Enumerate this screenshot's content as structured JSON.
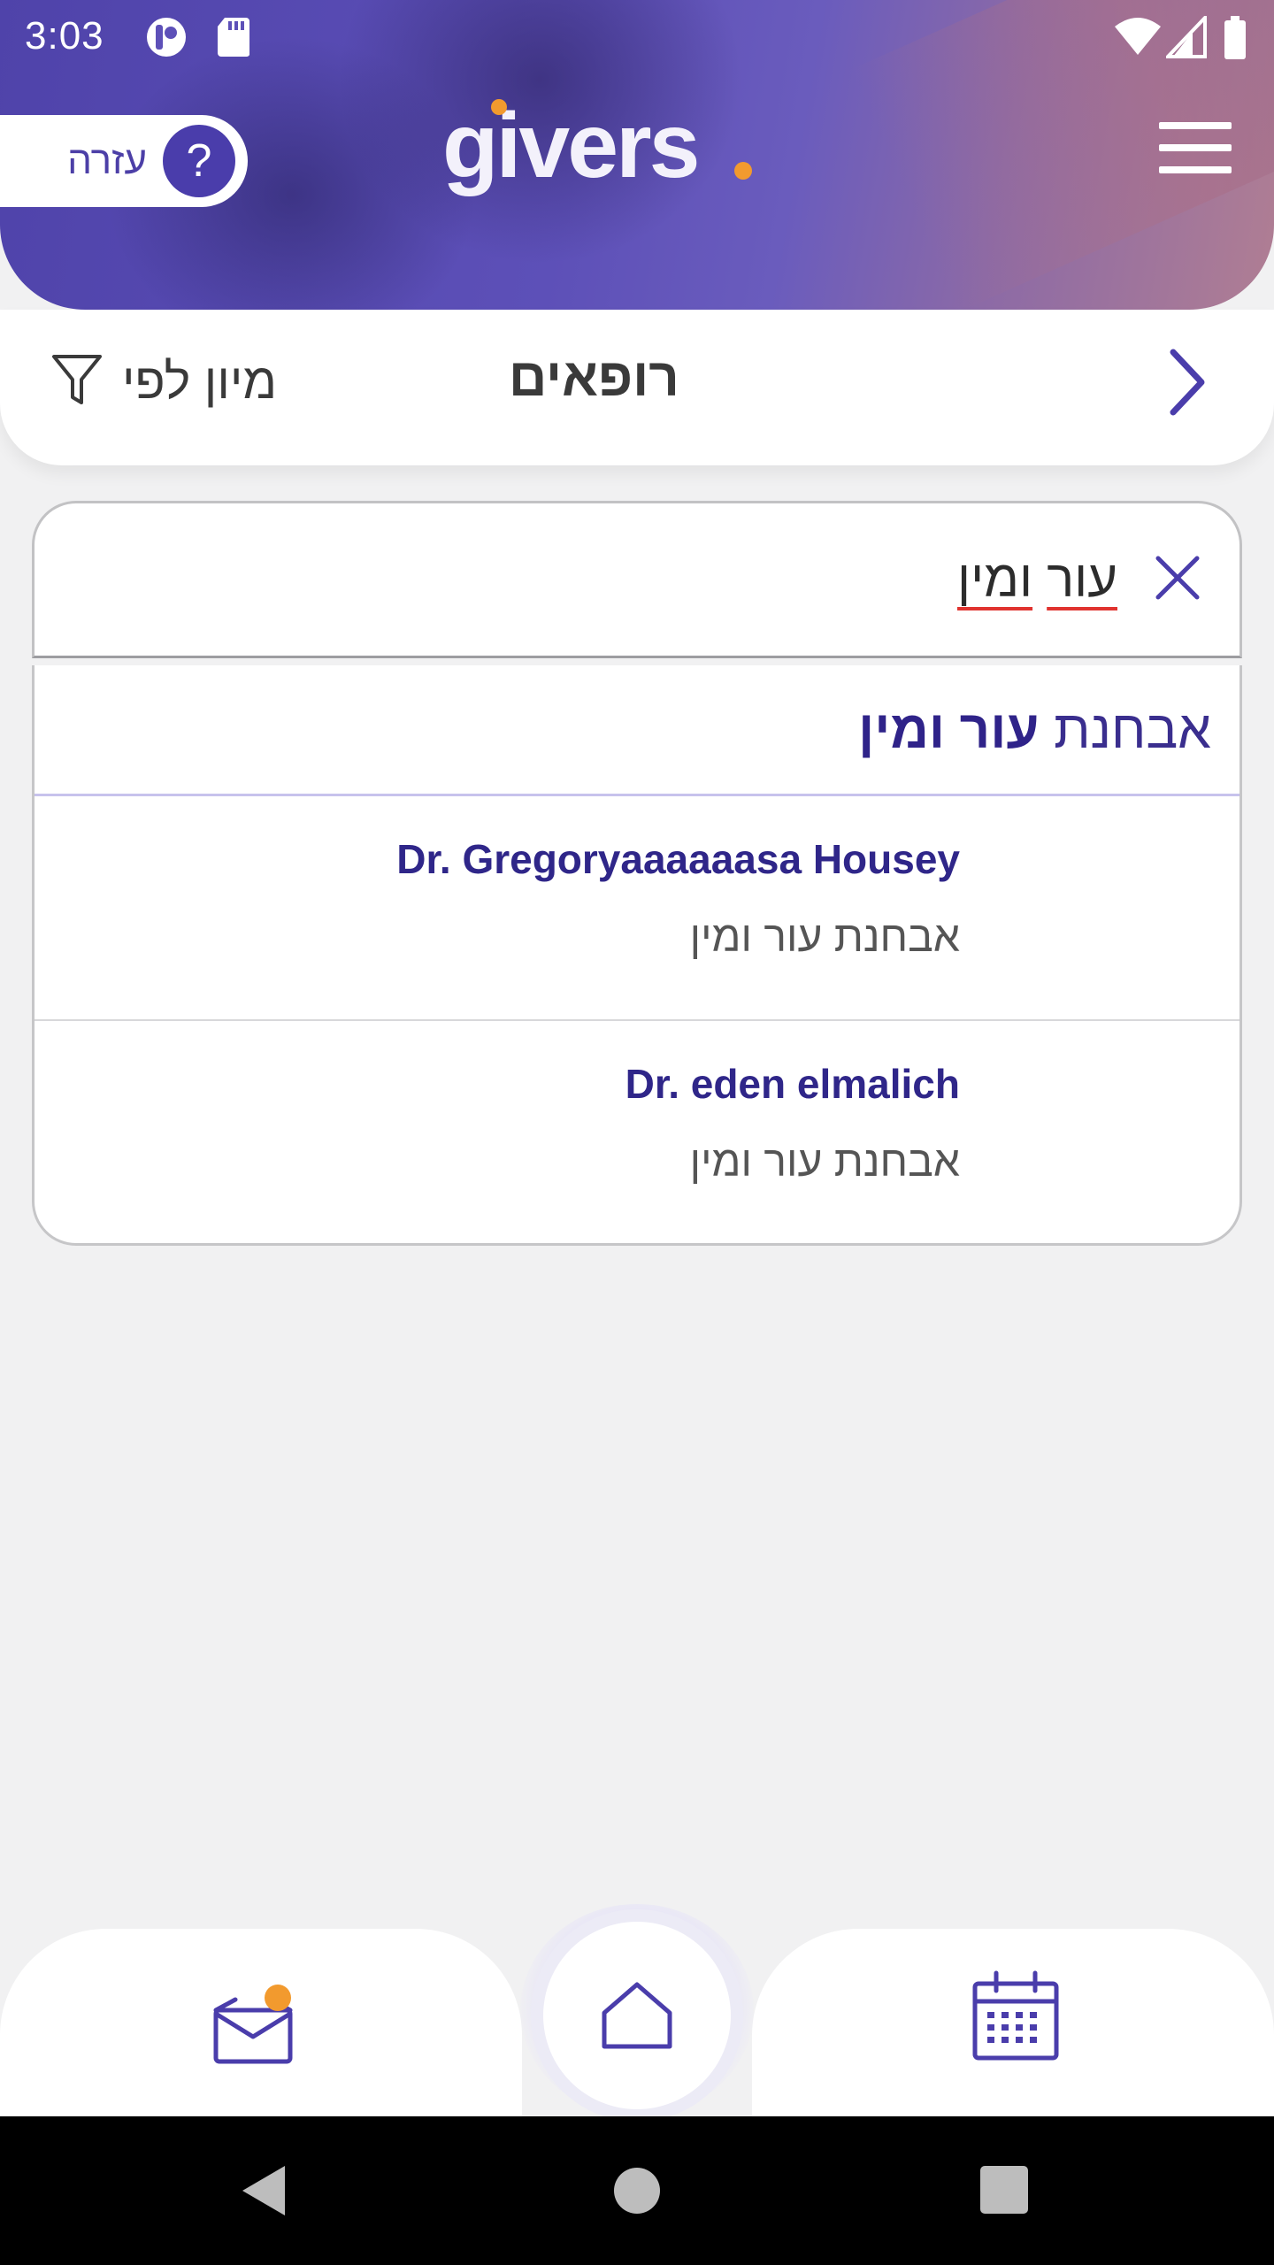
{
  "status_bar": {
    "time": "3:03"
  },
  "header": {
    "logo_text": "givers",
    "help_label": "עזרה",
    "help_symbol": "?",
    "menu_icon": "hamburger-menu-icon",
    "accent_color": "#4a3dab",
    "logo_dot_color": "#f29a2e"
  },
  "title_bar": {
    "title": "רופאים",
    "sort_label": "מיון לפי",
    "sort_icon": "filter-funnel-icon",
    "back_icon": "chevron-right-icon"
  },
  "search": {
    "value_word1": "עור",
    "value_word2": "ומין",
    "clear_icon": "close-x-icon"
  },
  "results": {
    "category": {
      "prefix": "אבחנת",
      "match": "עור ומין"
    },
    "doctors": [
      {
        "name": "Dr. Gregoryaaaaaasa Housey",
        "specialty": "אבחנת עור ומין"
      },
      {
        "name": "Dr. eden elmalich",
        "specialty": "אבחנת עור ומין"
      }
    ]
  },
  "bottom_nav": {
    "items": [
      {
        "icon": "mail-icon",
        "badge": true
      },
      {
        "icon": "home-icon"
      },
      {
        "icon": "calendar-icon"
      }
    ]
  }
}
